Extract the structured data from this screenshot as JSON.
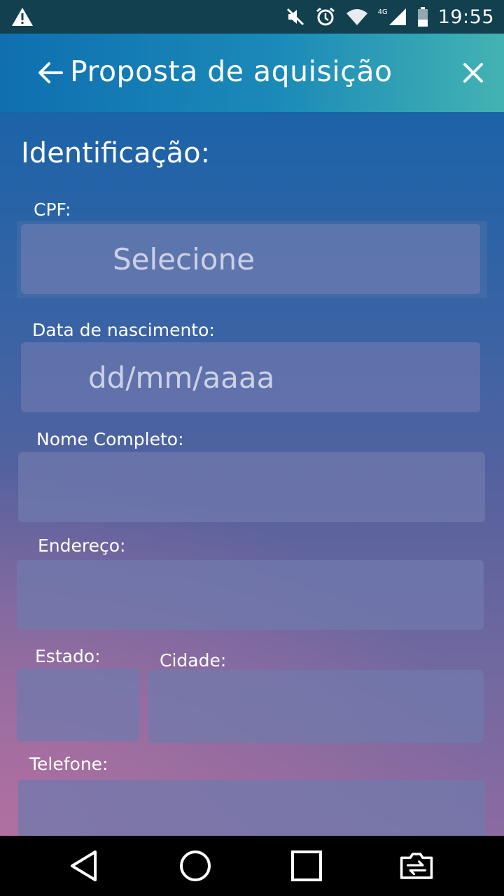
{
  "status_bar": {
    "time": "19:55",
    "network": "4G",
    "icons": [
      "warning-icon",
      "mute-icon",
      "alarm-icon",
      "wifi-icon",
      "signal-icon",
      "battery-icon"
    ]
  },
  "app_bar": {
    "title": "Proposta de aquisição",
    "back_icon": "arrow-left-icon",
    "close_icon": "close-icon"
  },
  "form": {
    "section_title": "Identificação:",
    "cpf": {
      "label": "CPF:",
      "value": "Selecione"
    },
    "birth_date": {
      "label": "Data de nascimento:",
      "placeholder": "dd/mm/aaaa"
    },
    "full_name": {
      "label": "Nome Completo:",
      "value": ""
    },
    "address": {
      "label": "Endereço:",
      "value": ""
    },
    "state": {
      "label": "Estado:",
      "value": ""
    },
    "city": {
      "label": "Cidade:",
      "value": ""
    },
    "phone": {
      "label": "Telefone:",
      "value": ""
    }
  },
  "nav_bar": {
    "icons": [
      "back-triangle-icon",
      "home-circle-icon",
      "recents-square-icon",
      "switch-camera-icon"
    ]
  }
}
